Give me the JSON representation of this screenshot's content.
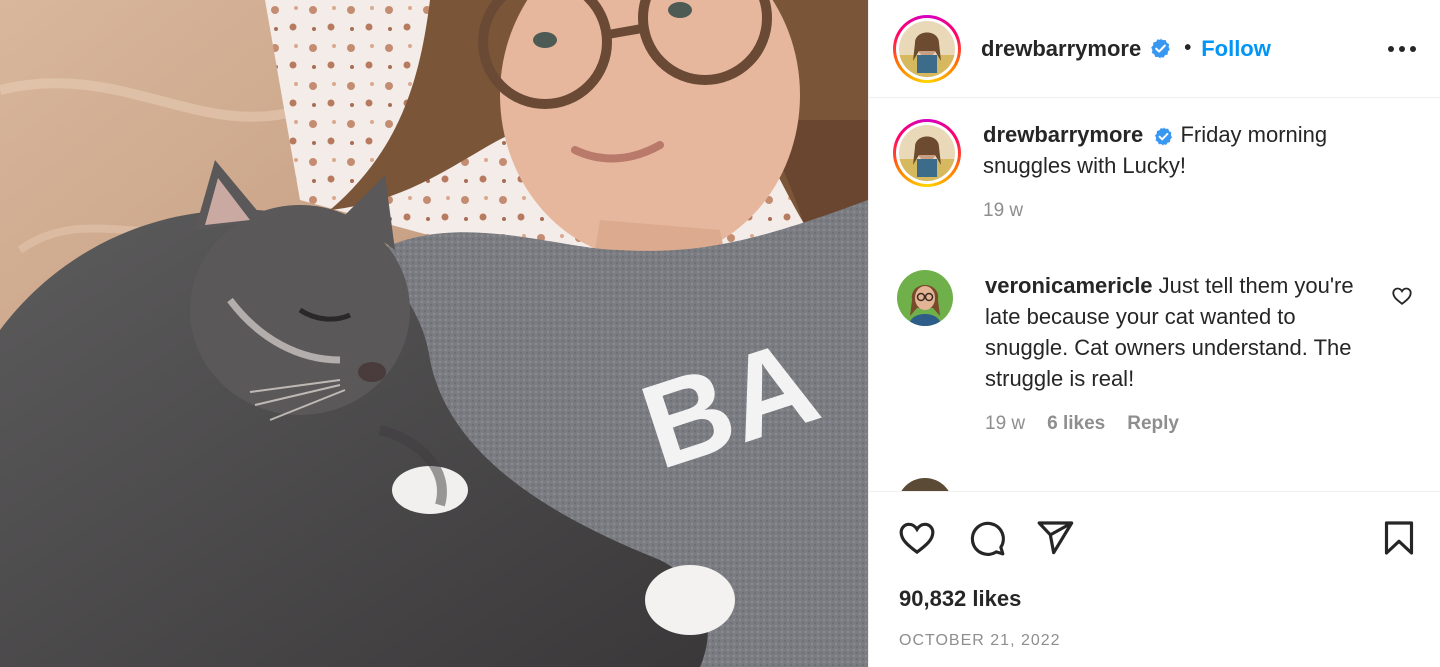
{
  "media": {
    "alt_hint": "photo of a woman with glasses lying in bed next to a sleeping grey cat",
    "shirt_text": "BA"
  },
  "header": {
    "username": "drewbarrymore",
    "separator": "•",
    "follow_label": "Follow",
    "more_icon": "more-horizontal-icon"
  },
  "caption": {
    "username": "drewbarrymore",
    "text": "Friday morning snuggles with Lucky!",
    "age": "19 w"
  },
  "comment": {
    "username": "veronicamericle",
    "text": "Just tell them you're late because your cat wanted to snuggle. Cat owners understand. The struggle is real!",
    "age": "19 w",
    "likes": "6 likes",
    "reply_label": "Reply"
  },
  "actions": {
    "icons": [
      "heart-icon",
      "comment-icon",
      "share-icon",
      "bookmark-icon"
    ],
    "likes_count": "90,832 likes",
    "date": "OCTOBER 21, 2022"
  },
  "colors": {
    "accent": "#0095f6",
    "verified": "#3897f0",
    "muted": "#8e8e8e",
    "text": "#262626"
  }
}
